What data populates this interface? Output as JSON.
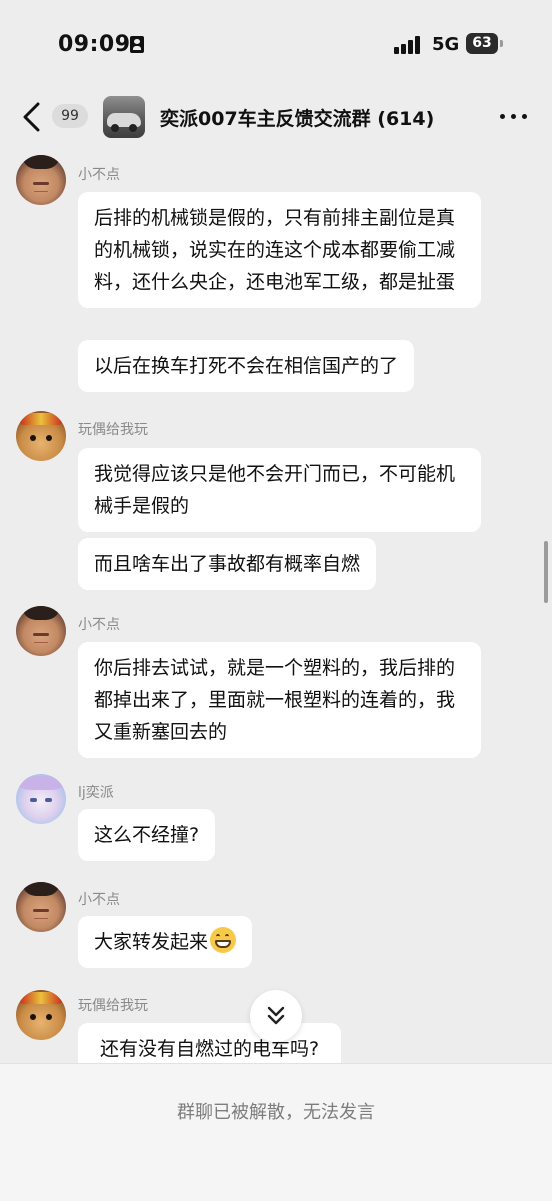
{
  "status_bar": {
    "time": "09:09",
    "network": "5G",
    "battery": "63"
  },
  "header": {
    "unread_count": "99",
    "title": "奕派007车主反馈交流群 (614)"
  },
  "messages": [
    {
      "sender": "小不点",
      "avatar": "bald-man-avatar",
      "bubbles": [
        "后排的机械锁是假的，只有前排主副位是真的机械锁，说实在的连这个成本都要偷工减料，还什么央企，还电池军工级，都是扯蛋",
        "以后在换车打死不会在相信国产的了"
      ]
    },
    {
      "sender": "玩偶给我玩",
      "avatar": "cat-avatar",
      "bubbles": [
        "我觉得应该只是他不会开门而已，不可能机械手是假的",
        "而且啥车出了事故都有概率自燃"
      ]
    },
    {
      "sender": "小不点",
      "avatar": "bald-man-avatar",
      "bubbles": [
        "你后排去试试，就是一个塑料的，我后排的都掉出来了，里面就一根塑料的连着的，我又重新塞回去的"
      ]
    },
    {
      "sender": "lj奕派",
      "avatar": "anime-avatar",
      "bubbles": [
        "这么不经撞?"
      ]
    },
    {
      "sender": "小不点",
      "avatar": "bald-man-avatar",
      "bubbles": [
        "大家转发起来"
      ],
      "emoji": "grinning-face-emoji"
    },
    {
      "sender": "玩偶给我玩",
      "avatar": "cat-avatar",
      "bubbles": [
        "还有没有自燃过的电车吗?"
      ]
    }
  ],
  "footer": {
    "notice": "群聊已被解散，无法发言"
  },
  "icons": {
    "back": "chevron-left-icon",
    "more": "more-dots-icon",
    "jump": "double-chevron-down-icon"
  }
}
